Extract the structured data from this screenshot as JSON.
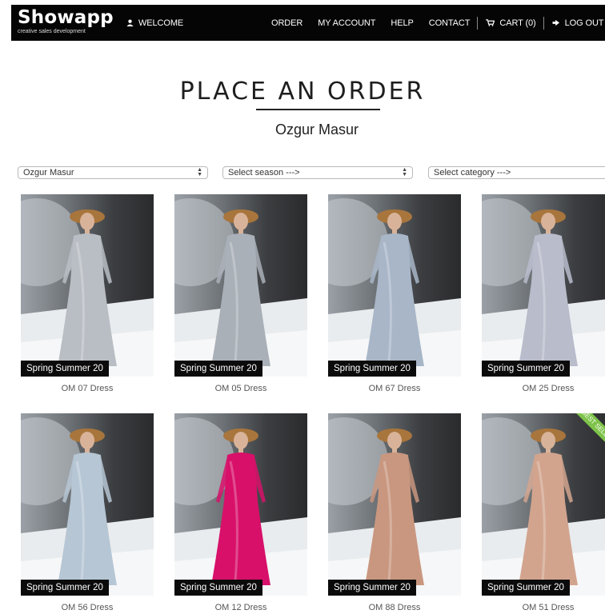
{
  "header": {
    "logo_name": "Showapp",
    "logo_tagline": "creative sales development",
    "welcome": "WELCOME",
    "nav": [
      "ORDER",
      "MY ACCOUNT",
      "HELP",
      "CONTACT"
    ],
    "cart": "CART (0)",
    "logout": "LOG OUT"
  },
  "page": {
    "title": "PLACE AN ORDER",
    "subtitle": "Ozgur Masur"
  },
  "filters": {
    "brand": "Ozgur Masur",
    "season": "Select season --->",
    "category": "Select category --->"
  },
  "products": [
    {
      "name": "OM 07 Dress",
      "season": "Spring Summer 20",
      "dress_color": "#b9bec4"
    },
    {
      "name": "OM 05 Dress",
      "season": "Spring Summer 20",
      "dress_color": "#aab0b8"
    },
    {
      "name": "OM 67 Dress",
      "season": "Spring Summer 20",
      "dress_color": "#a8b6c8"
    },
    {
      "name": "OM 25 Dress",
      "season": "Spring Summer 20",
      "dress_color": "#b8bccb"
    },
    {
      "name": "OM 56 Dress",
      "season": "Spring Summer 20",
      "dress_color": "#b6c6d4"
    },
    {
      "name": "OM 12 Dress",
      "season": "Spring Summer 20",
      "dress_color": "#d8106a"
    },
    {
      "name": "OM 88 Dress",
      "season": "Spring Summer 20",
      "dress_color": "#c9977f"
    },
    {
      "name": "OM 51 Dress",
      "season": "Spring Summer 20",
      "dress_color": "#d2a48e",
      "ribbon": "BEST SELLER"
    }
  ],
  "colors": {
    "topbar": "#050505",
    "ribbon": "#7ec34a",
    "badge": "#0b0b0b"
  }
}
